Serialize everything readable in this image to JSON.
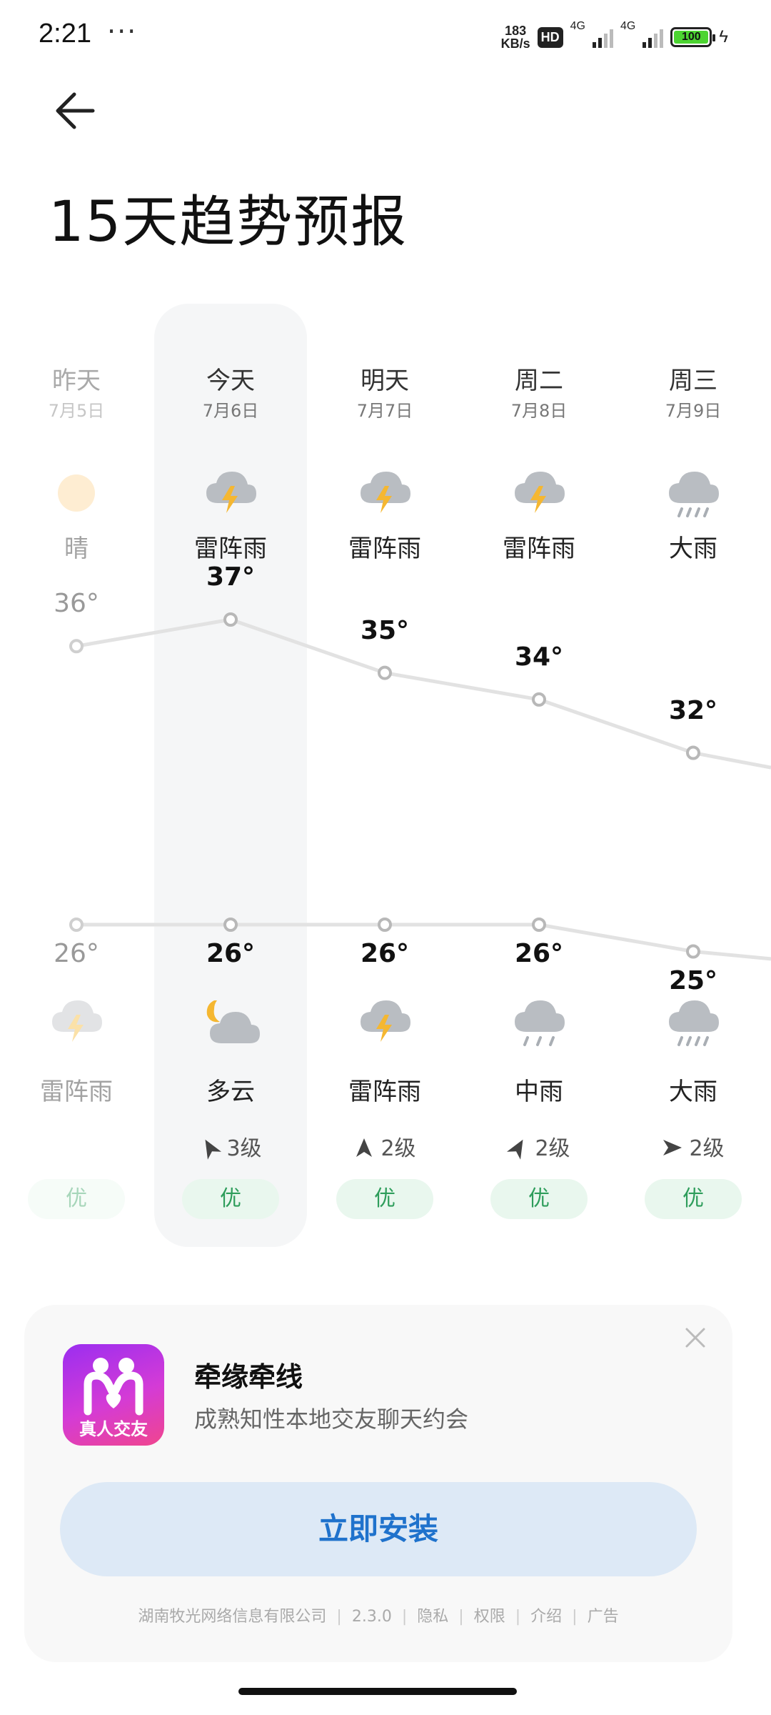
{
  "status_bar": {
    "time": "2:21",
    "dots": "···",
    "speed_value": "183",
    "speed_unit": "KB/s",
    "hd_label": "HD",
    "net1": "4G",
    "net2": "4G",
    "battery": "100"
  },
  "page": {
    "title": "15天趋势预报"
  },
  "forecast": {
    "days": [
      {
        "name": "昨天",
        "date": "7月5日",
        "day_icon": "sun-icon",
        "day_cond": "晴",
        "high": "36°",
        "low": "26°",
        "night_icon": "thunderstorm-icon",
        "night_cond": "雷阵雨",
        "wind": "",
        "aqi": "优"
      },
      {
        "name": "今天",
        "date": "7月6日",
        "day_icon": "thunderstorm-icon",
        "day_cond": "雷阵雨",
        "high": "37°",
        "low": "26°",
        "night_icon": "partly-cloudy-night-icon",
        "night_cond": "多云",
        "wind": "3级",
        "aqi": "优"
      },
      {
        "name": "明天",
        "date": "7月7日",
        "day_icon": "thunderstorm-icon",
        "day_cond": "雷阵雨",
        "high": "35°",
        "low": "26°",
        "night_icon": "thunderstorm-icon",
        "night_cond": "雷阵雨",
        "wind": "2级",
        "aqi": "优"
      },
      {
        "name": "周二",
        "date": "7月8日",
        "day_icon": "thunderstorm-icon",
        "day_cond": "雷阵雨",
        "high": "34°",
        "low": "26°",
        "night_icon": "moderate-rain-icon",
        "night_cond": "中雨",
        "wind": "2级",
        "aqi": "优"
      },
      {
        "name": "周三",
        "date": "7月9日",
        "day_icon": "heavy-rain-icon",
        "day_cond": "大雨",
        "high": "32°",
        "low": "25°",
        "night_icon": "heavy-rain-icon",
        "night_cond": "大雨",
        "wind": "2级",
        "aqi": "优"
      }
    ]
  },
  "ad": {
    "app_name": "牵缘牵线",
    "description": "成熟知性本地交友聊天约会",
    "logo_text": "真人交友",
    "install_label": "立即安装",
    "footer_company": "湖南牧光网络信息有限公司",
    "footer_version": "2.3.0",
    "footer_privacy": "隐私",
    "footer_permissions": "权限",
    "footer_intro": "介绍",
    "footer_ad": "广告"
  },
  "colors": {
    "accent_blue": "#1f72cc",
    "aqi_green": "#2e9d5b",
    "battery_green": "#4cd431"
  }
}
